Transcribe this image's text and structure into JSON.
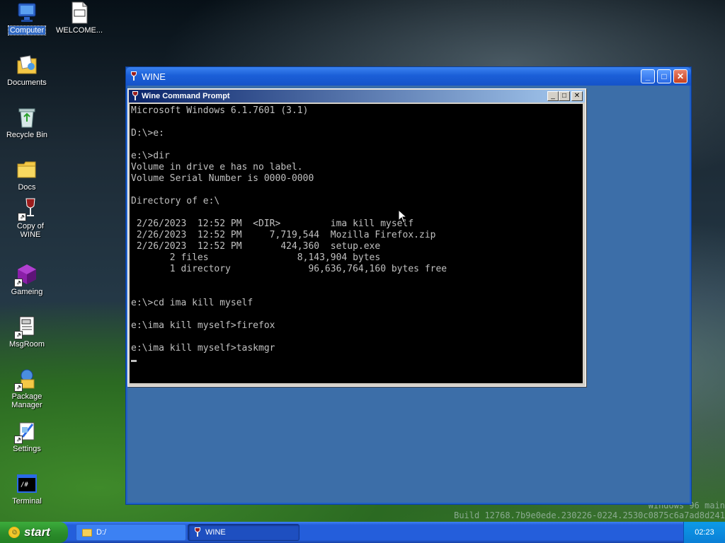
{
  "desktop": {
    "icons": [
      {
        "label": "Computer",
        "icon": "computer-icon"
      },
      {
        "label": "WELCOME...",
        "icon": "markdown-file-icon"
      },
      {
        "label": "Documents",
        "icon": "documents-icon"
      },
      {
        "label": "Recycle Bin",
        "icon": "recycle-bin-icon"
      },
      {
        "label": "Docs",
        "icon": "folder-icon"
      },
      {
        "label": "Copy of WINE",
        "icon": "wine-glass-icon"
      },
      {
        "label": "Gameing",
        "icon": "cube-icon"
      },
      {
        "label": "MsgRoom",
        "icon": "chat-icon"
      },
      {
        "label": "Package Manager",
        "icon": "package-icon"
      },
      {
        "label": "Settings",
        "icon": "settings-icon"
      },
      {
        "label": "Terminal",
        "icon": "terminal-icon"
      }
    ],
    "welcome_glyph": "M↓"
  },
  "wine_window": {
    "title": "WINE",
    "buttons": {
      "minimize": "_",
      "maximize": "□",
      "close": "✕"
    }
  },
  "cmd_window": {
    "title": "Wine Command Prompt",
    "buttons": {
      "minimize": "_",
      "maximize": "□",
      "close": "✕"
    },
    "lines": [
      "Microsoft Windows 6.1.7601 (3.1)",
      "",
      "D:\\>e:",
      "",
      "e:\\>dir",
      "Volume in drive e has no label.",
      "Volume Serial Number is 0000-0000",
      "",
      "Directory of e:\\",
      "",
      " 2/26/2023  12:52 PM  <DIR>         ima kill myself",
      " 2/26/2023  12:52 PM     7,719,544  Mozilla Firefox.zip",
      " 2/26/2023  12:52 PM       424,360  setup.exe",
      "       2 files                8,143,904 bytes",
      "       1 directory              96,636,764,160 bytes free",
      "",
      "",
      "e:\\>cd ima kill myself",
      "",
      "e:\\ima kill myself>firefox",
      "",
      "e:\\ima kill myself>taskmgr",
      ""
    ]
  },
  "watermark": {
    "line1": "Windows 96 main",
    "line2": "Build 12768.7b9e0ede.230226-0224.2530c0875c6a7ad8d241"
  },
  "taskbar": {
    "start_label": "start",
    "tasks": [
      {
        "label": "D:/",
        "icon": "folder-icon",
        "active": false
      },
      {
        "label": "WINE",
        "icon": "wine-glass-icon",
        "active": true
      }
    ],
    "clock": "02:23"
  }
}
